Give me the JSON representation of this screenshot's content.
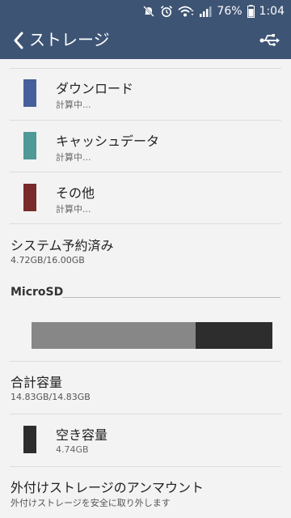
{
  "status": {
    "battery": "76%",
    "time": "1:04"
  },
  "appbar": {
    "title": "ストレージ"
  },
  "categories": [
    {
      "label": "ダウンロード",
      "sub": "計算中...",
      "color": "#475f9a"
    },
    {
      "label": "キャッシュデータ",
      "sub": "計算中...",
      "color": "#4f9996"
    },
    {
      "label": "その他",
      "sub": "計算中...",
      "color": "#7a2a2c"
    }
  ],
  "system": {
    "title": "システム予約済み",
    "value": "4.72GB/16.00GB"
  },
  "microsd": {
    "section_label": "MicroSD",
    "usage_bar": {
      "used_fraction": 0.68,
      "used_color": "#878787",
      "free_color": "#2d2d2d"
    }
  },
  "total": {
    "title": "合計容量",
    "value": "14.83GB/14.83GB"
  },
  "free": {
    "label": "空き容量",
    "value": "4.74GB",
    "color": "#2d2d2d"
  },
  "unmount": {
    "title": "外付けストレージのアンマウント",
    "sub": "外付けストレージを安全に取り外します"
  }
}
